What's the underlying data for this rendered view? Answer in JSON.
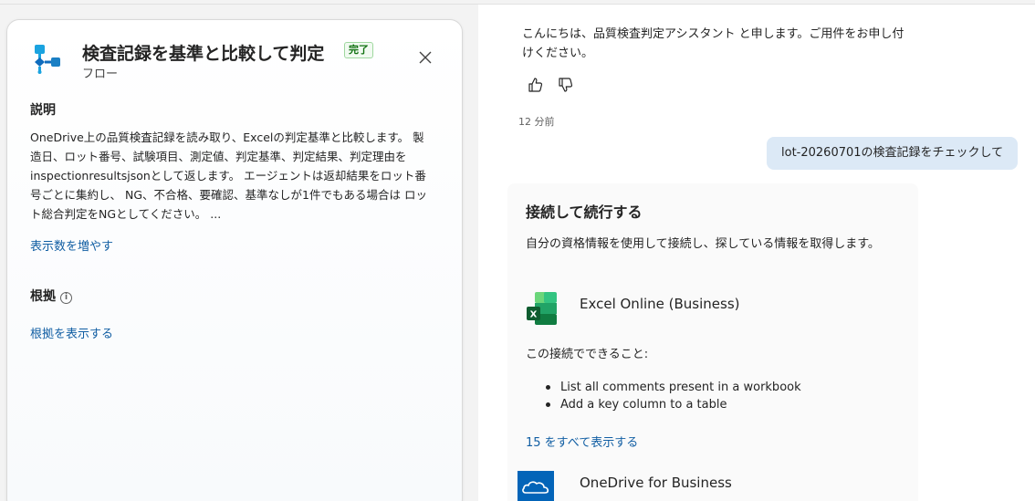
{
  "flow_card": {
    "title": "検査記録を基準と比較して判定",
    "status_badge": "完了",
    "subtitle": "フロー",
    "description_heading": "説明",
    "description_text": "OneDrive上の品質検査記録を読み取り、Excelの判定基準と比較します。 製造日、ロット番号、試験項目、測定値、判定基準、判定結果、判定理由をinspectionresultsjsonとして返します。 エージェントは返却結果をロット番号ごとに集約し、 NG、不合格、要確認、基準なしが1件でもある場合は ロット総合判定をNGとしてください。 ...",
    "show_more_link": "表示数を増やす",
    "evidence_heading": "根拠",
    "show_evidence_link": "根拠を表示する",
    "icons": {
      "flow": "flow-icon",
      "close": "close-icon",
      "info": "info-icon"
    }
  },
  "chat": {
    "bot_message": "こんにちは、品質検査判定アシスタント と申します。ご用件をお申し付けください。",
    "timestamp": "12 分前",
    "user_message": "lot-20260701の検査記録をチェックして",
    "connect_card": {
      "title": "接続して続行する",
      "description": "自分の資格情報を使用して接続し、探している情報を取得します。",
      "connector_1": "Excel Online (Business)",
      "capabilities_label": "この接続でできること:",
      "capabilities": [
        "List all comments present in a workbook",
        "Add a key column to a table"
      ],
      "show_all_link": "15 をすべて表示する",
      "connector_2": "OneDrive for Business"
    },
    "icons": {
      "like": "thumbs-up-icon",
      "dislike": "thumbs-down-icon",
      "excel": "excel-icon",
      "onedrive": "onedrive-icon"
    }
  },
  "colors": {
    "link": "#115ea3",
    "badge_text": "#0e700e",
    "user_bubble": "#dce9f6",
    "flow_icon": "#0f6cbd"
  }
}
